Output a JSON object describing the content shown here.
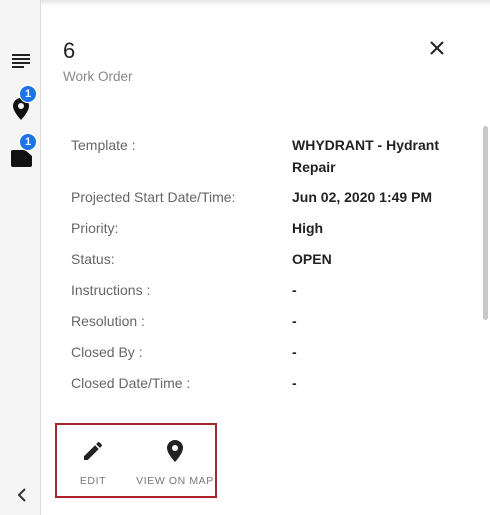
{
  "rail": {
    "location_badge": "1",
    "note_badge": "1"
  },
  "header": {
    "title": "6",
    "subtitle": "Work Order"
  },
  "details": [
    {
      "label": "Template :",
      "value": "WHYDRANT - Hydrant Repair"
    },
    {
      "label": "Projected Start Date/Time:",
      "value": "Jun 02, 2020 1:49 PM"
    },
    {
      "label": "Priority:",
      "value": "High"
    },
    {
      "label": "Status:",
      "value": "OPEN"
    },
    {
      "label": "Instructions :",
      "value": "-"
    },
    {
      "label": "Resolution :",
      "value": "-"
    },
    {
      "label": "Closed By :",
      "value": "-"
    },
    {
      "label": "Closed Date/Time :",
      "value": "-"
    }
  ],
  "actions": {
    "edit_label": "EDIT",
    "map_label": "VIEW ON MAP"
  },
  "icons": {
    "menu": "list-icon",
    "location": "map-pin-icon",
    "note": "note-icon",
    "close": "close-icon",
    "edit": "pencil-icon",
    "map": "map-pin-icon",
    "collapse": "chevron-left-icon"
  },
  "colors": {
    "badge": "#1a73e8",
    "highlight_border": "#a8232a"
  }
}
